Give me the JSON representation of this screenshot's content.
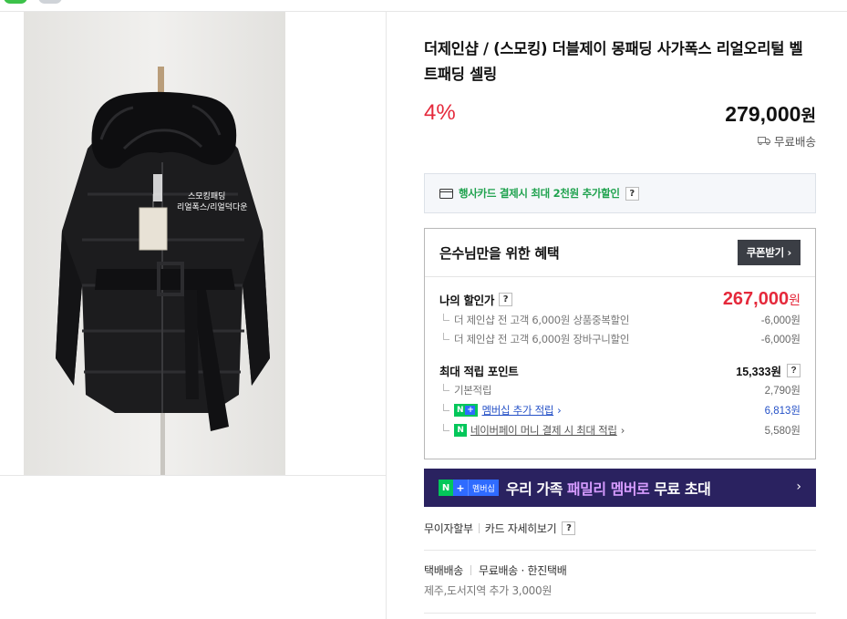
{
  "product": {
    "title": "더제인샵 / (스모킹) 더블제이 몽패딩 사가폭스 리얼오리털 벨트패딩 셀링",
    "discount": "4%",
    "price": "279,000",
    "price_unit": "원",
    "shipping_badge": "무료배송",
    "photo_caption_1": "스모킹패딩",
    "photo_caption_2": "리얼폭스/리얼덕다운"
  },
  "card_promo": {
    "text": "행사카드 결제시 최대 2천원 추가할인",
    "help": "?"
  },
  "benefit": {
    "title": "은수님만을 위한 혜택",
    "coupon_button": "쿠폰받기 ›",
    "my_price_label": "나의 할인가",
    "my_price": "267,000",
    "my_price_unit": "원",
    "discounts": [
      {
        "label": "더 제인샵 전 고객 6,000원 상품중복할인",
        "value": "-6,000원"
      },
      {
        "label": "더 제인샵 전 고객 6,000원 장바구니할인",
        "value": "-6,000원"
      }
    ],
    "points_label": "최대 적립 포인트",
    "points_value": "15,333원",
    "point_rows": [
      {
        "label": "기본적립",
        "value": "2,790원"
      },
      {
        "label": "멤버십 추가 적립",
        "value": "6,813원"
      },
      {
        "label": "네이버페이 머니 결제 시 최대 적립",
        "value": "5,580원"
      }
    ]
  },
  "banner": {
    "badge_n": "N",
    "badge_plus": "+",
    "badge_membership": "멤버십",
    "text_pre": "우리 가족 ",
    "text_highlight": "패밀리 멤버로",
    "text_post": " 무료 초대"
  },
  "links": {
    "installment": "무이자할부",
    "card_detail": "카드 자세히보기",
    "help": "?"
  },
  "delivery": {
    "type": "택배배송",
    "info": "무료배송 · 한진택배",
    "extra": "제주,도서지역 추가 3,000원"
  },
  "colors": {
    "discount_red": "#e5293b",
    "naver_green": "#03c75a",
    "banner_bg": "#2a2260",
    "banner_highlight": "#d69cff",
    "link_blue": "#2551c7"
  }
}
